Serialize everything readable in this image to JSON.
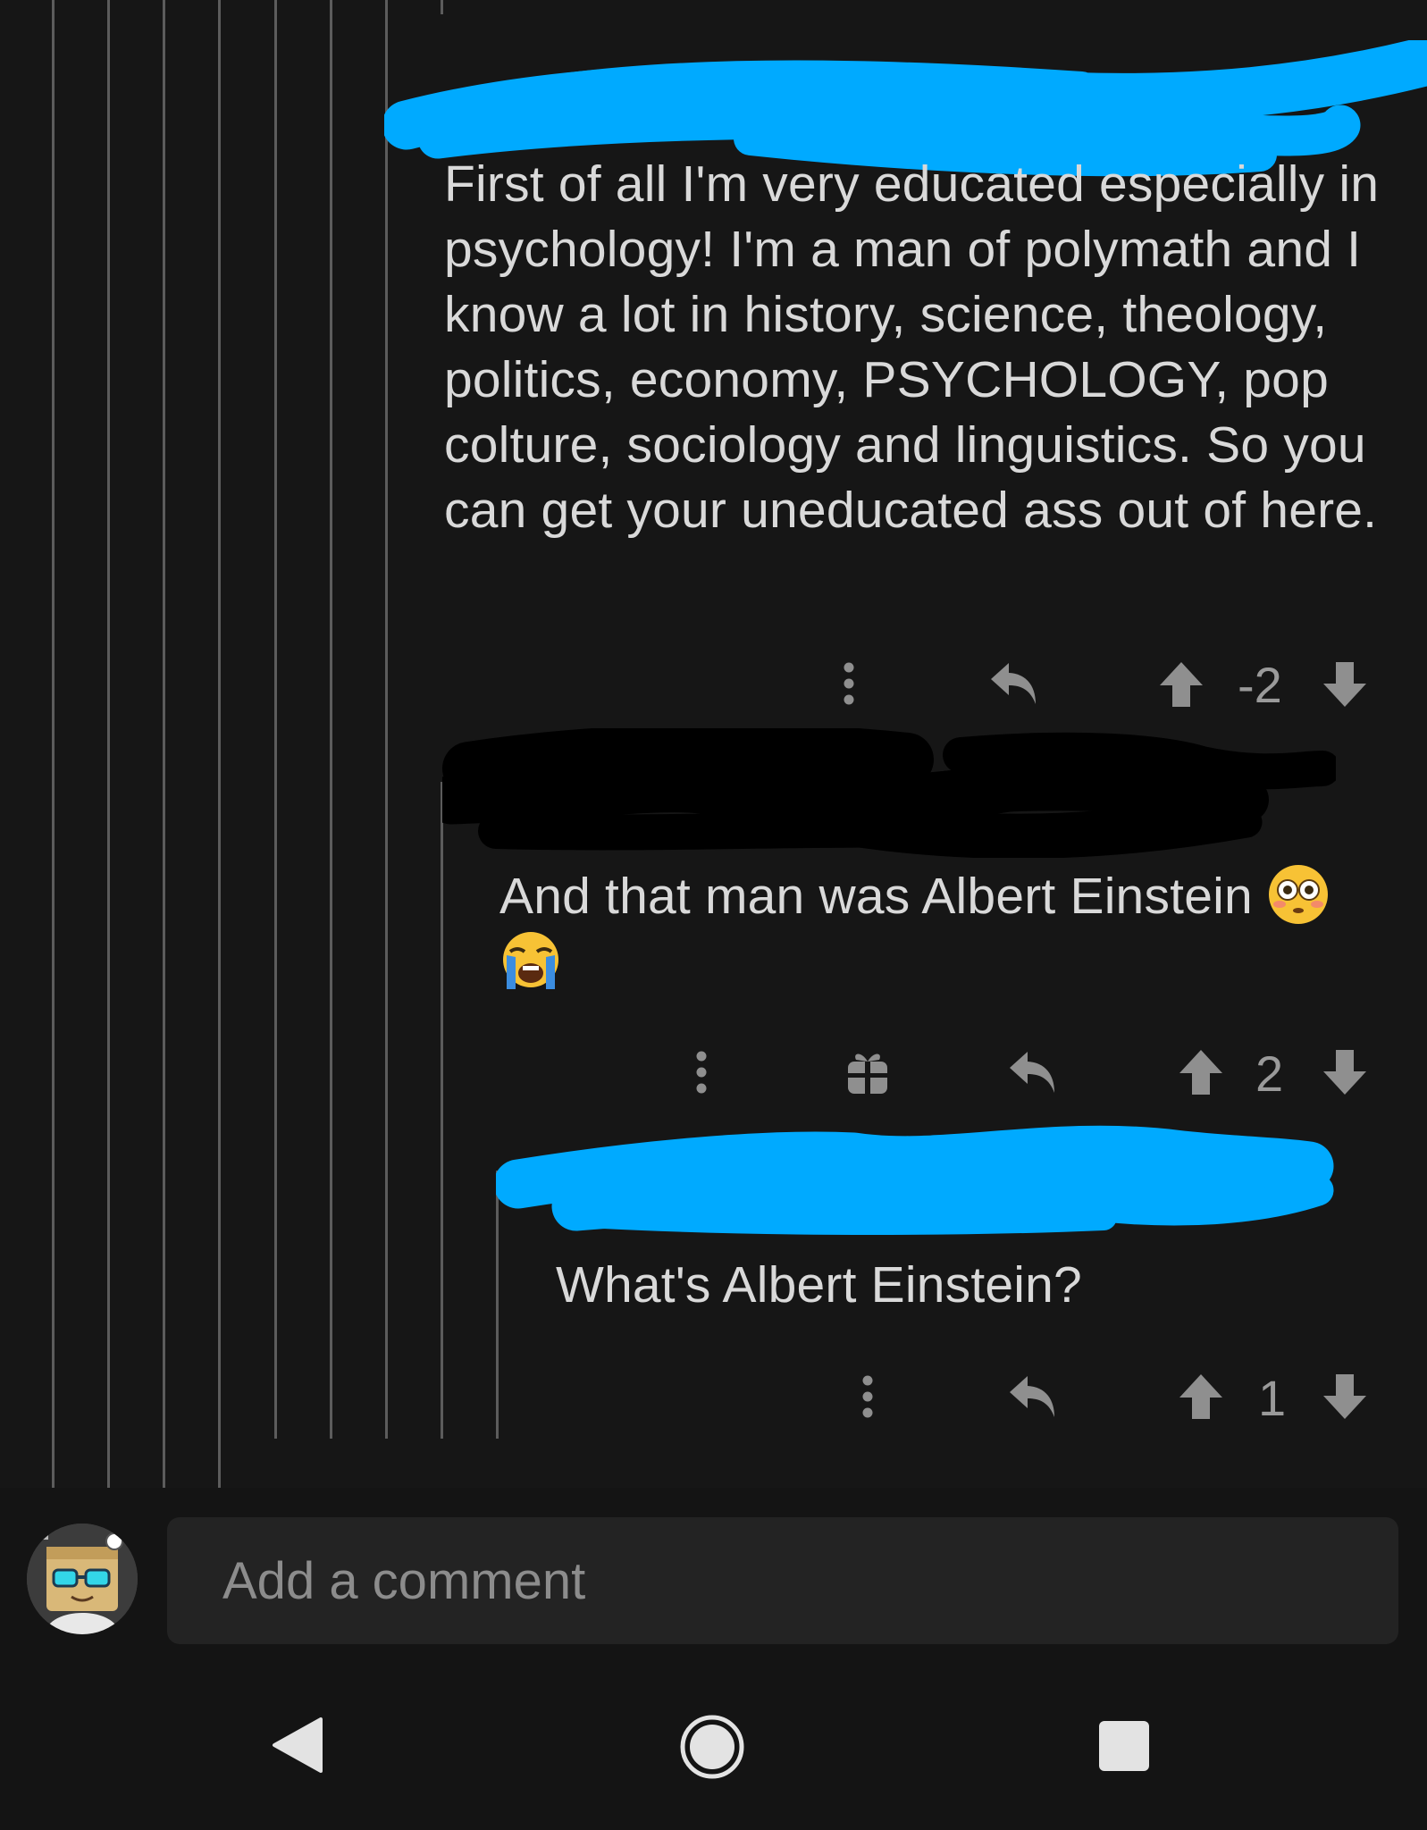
{
  "comments": [
    {
      "body": "First of all I'm very educated especially in psychology! I'm a man of polymath and I know a lot in history, science, theology, politics, economy, PSYCHOLOGY, pop colture, sociology and linguistics. So you can get your uneducated ass out of here.",
      "score": "-2",
      "author_redaction_color": "#00aaff"
    },
    {
      "body": "And that man was Albert Einstein",
      "emojis": [
        "flushed-face-emoji",
        "loudly-crying-face-emoji"
      ],
      "score": "2",
      "author_redaction_color": "#000000"
    },
    {
      "body": "What's Albert Einstein?",
      "score": "1",
      "author_redaction_color": "#00aaff"
    }
  ],
  "composer": {
    "placeholder": "Add a comment"
  },
  "icons": {
    "more": "more-vertical-icon",
    "reply": "reply-icon",
    "upvote": "upvote-arrow-icon",
    "downvote": "downvote-arrow-icon",
    "award": "gift-award-icon",
    "nav_back": "back-triangle-icon",
    "nav_home": "home-circle-icon",
    "nav_recents": "recents-square-icon"
  },
  "colors": {
    "background": "#161616",
    "text": "#d9d9d9",
    "muted": "#8f8f8f",
    "redaction_blue": "#00aaff",
    "thread_line": "#5c5c5c"
  }
}
